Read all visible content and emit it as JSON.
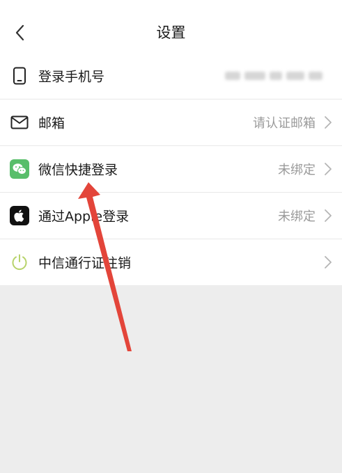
{
  "header": {
    "title": "设置"
  },
  "list": [
    {
      "id": "phone",
      "label": "登录手机号",
      "value": "",
      "icon": "phone-icon",
      "has_chevron": false,
      "value_blurred": true
    },
    {
      "id": "mail",
      "label": "邮箱",
      "value": "请认证邮箱",
      "icon": "mail-icon",
      "has_chevron": true
    },
    {
      "id": "wechat",
      "label": "微信快捷登录",
      "value": "未绑定",
      "icon": "wechat-icon",
      "has_chevron": true
    },
    {
      "id": "apple",
      "label": "通过Apple登录",
      "value": "未绑定",
      "icon": "apple-icon",
      "has_chevron": true
    },
    {
      "id": "cancel",
      "label": "中信通行证注销",
      "value": "",
      "icon": "power-icon",
      "has_chevron": true
    }
  ],
  "colors": {
    "wechat_green": "#58be6a",
    "power_green": "#b7d36b",
    "arrow_red": "#e3453a"
  }
}
